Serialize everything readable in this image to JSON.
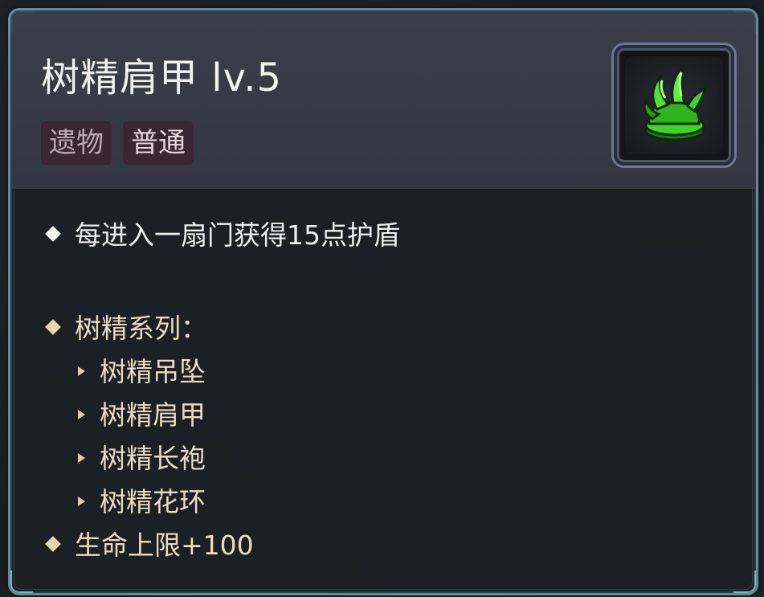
{
  "item": {
    "title": "树精肩甲 lv.5",
    "tags": [
      "遗物",
      "普通"
    ],
    "icon": "green-vine-pauldron-icon"
  },
  "description": {
    "effect": "每进入一扇门获得15点护盾",
    "set_title": "树精系列：",
    "set_items": [
      "树精吊坠",
      "树精肩甲",
      "树精长袍",
      "树精花环"
    ],
    "set_bonus": "生命上限+100"
  },
  "colors": {
    "frame": "#5a8d95",
    "header_bg": "#3e404c",
    "tag_bg": "#3b2635",
    "set_text": "#e8dcc0",
    "icon_green": "#3fd42a"
  }
}
